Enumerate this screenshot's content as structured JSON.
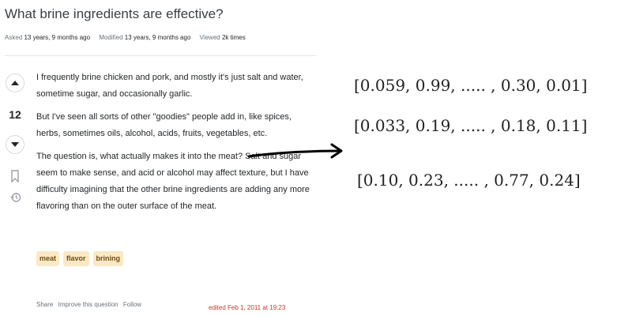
{
  "question": {
    "title": "What brine ingredients are effective?",
    "meta": {
      "asked_label": "Asked",
      "asked_value": "13 years, 9 months ago",
      "modified_label": "Modified",
      "modified_value": "13 years, 9 months ago",
      "viewed_label": "Viewed",
      "viewed_value": "2k times"
    },
    "vote_count": "12",
    "body": [
      "I frequently brine chicken and pork, and mostly it's just salt and water, sometime sugar, and occasionally garlic.",
      "But I've seen all sorts of other \"goodies\" people add in, like spices, herbs, sometimes oils, alcohol, acids, fruits, vegetables, etc.",
      "The question is, what actually makes it into the meat? Salt and sugar seem to make sense, and acid or alcohol may affect texture, but I have difficulty imagining that the other brine ingredients are adding any more flavoring than on the outer surface of the meat."
    ],
    "tags": [
      "meat",
      "flavor",
      "brining"
    ],
    "actions": {
      "share": "Share",
      "improve": "Improve this question",
      "follow": "Follow"
    },
    "edited": "edited Feb 1, 2011 at 19:23"
  },
  "vectors": [
    "[0.059, 0.99, ..... , 0.30, 0.01]",
    "[0.033, 0.19, ..... , 0.18, 0.11]",
    "[0.10, 0.23, ..... , 0.77, 0.24]"
  ],
  "icons": {
    "upvote": "arrow-up-icon",
    "downvote": "arrow-down-icon",
    "bookmark": "bookmark-icon",
    "history": "history-icon",
    "arrow": "right-arrow-icon"
  },
  "colors": {
    "tag_bg": "#fbe8c6",
    "tag_text": "#6b4f12",
    "edited": "#c0392b",
    "muted": "#6a737c"
  }
}
